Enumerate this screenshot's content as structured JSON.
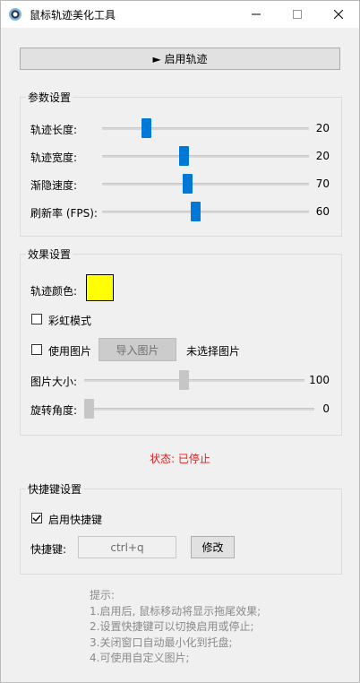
{
  "window": {
    "title": "鼠标轨迹美化工具",
    "icon": "mouse-trail-app-icon"
  },
  "controls": {
    "start_button": "► 启用轨迹"
  },
  "params": {
    "legend": "参数设置",
    "sliders": [
      {
        "label": "轨迹长度:",
        "value": "20",
        "fraction": 0.2
      },
      {
        "label": "轨迹宽度:",
        "value": "20",
        "fraction": 0.39
      },
      {
        "label": "渐隐速度:",
        "value": "70",
        "fraction": 0.41
      },
      {
        "label": "刷新率 (FPS):",
        "value": "60",
        "fraction": 0.45
      }
    ]
  },
  "effects": {
    "legend": "效果设置",
    "color_label": "轨迹颜色:",
    "trail_color": "#ffff00",
    "rainbow_label": "彩虹模式",
    "rainbow_checked": false,
    "use_image_label": "使用图片",
    "use_image_checked": false,
    "import_button": "导入图片",
    "image_status": "未选择图片",
    "image_size_label": "图片大小:",
    "image_size_value": "100",
    "image_size_fraction": 0.45,
    "rotation_label": "旋转角度:",
    "rotation_value": "0",
    "rotation_fraction": 0.0
  },
  "status": {
    "text": "状态: 已停止",
    "color": "#e01e1e"
  },
  "hotkey": {
    "legend": "快捷键设置",
    "enable_label": "启用快捷键",
    "enable_checked": true,
    "hotkey_label": "快捷键:",
    "hotkey_value": "ctrl+q",
    "modify_button": "修改"
  },
  "tips": {
    "title": "提示:",
    "lines": [
      "1.启用后, 鼠标移动将显示拖尾效果;",
      "2.设置快捷键可以切换启用或停止;",
      "3.关闭窗口自动最小化到托盘;",
      "4.可使用自定义图片;"
    ]
  }
}
